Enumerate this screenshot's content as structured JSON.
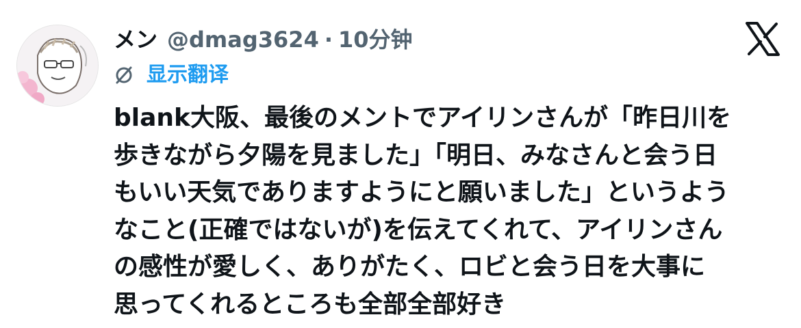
{
  "tweet": {
    "author": {
      "display_name": "メン",
      "handle": "@dmag3624",
      "avatar_icon": "avatar-illustration"
    },
    "separator": "·",
    "timestamp": "10分钟",
    "platform_icon": "x-logo-icon",
    "translate": {
      "icon": "translate-icon",
      "label": "显示翻译"
    },
    "text_lines": [
      "blank大阪、最後のメントでアイリンさんが「昨日川を",
      "歩きながら夕陽を見ました」「明日、みなさんと会う日",
      "もいい天気でありますようにと願いました」というよう",
      "なこと(正確ではないが)を伝えてくれて、アイリンさん",
      "の感性が愛しく、ありがたく、ロビと会う日を大事に",
      "思ってくれるところも全部全部好き"
    ]
  },
  "colors": {
    "text_primary": "#0f1419",
    "text_secondary": "#536471",
    "link_blue": "#1d9bf0",
    "background": "#ffffff"
  }
}
